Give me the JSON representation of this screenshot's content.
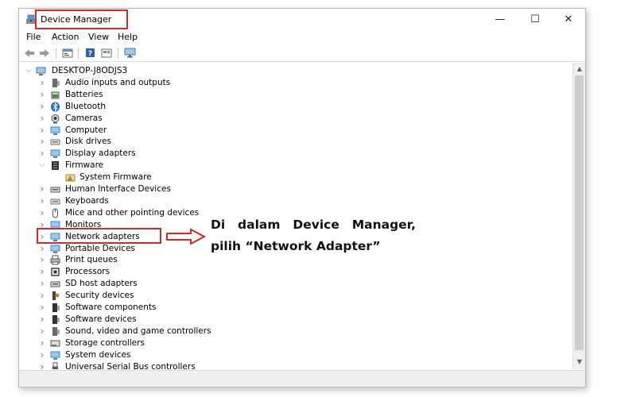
{
  "window": {
    "title": "Device Manager",
    "controls": {
      "minimize": "—",
      "maximize": "☐",
      "close": "✕"
    }
  },
  "menu": [
    "File",
    "Action",
    "View",
    "Help"
  ],
  "toolbar": {
    "buttons": [
      "back-icon",
      "forward-icon",
      "properties-icon",
      "help-icon",
      "view-icon",
      "monitor-icon"
    ]
  },
  "tree": {
    "root": "DESKTOP-J8ODJS3",
    "items": [
      {
        "label": "Audio inputs and outputs",
        "icon": "speaker-icon",
        "color": "#6b6b6b"
      },
      {
        "label": "Batteries",
        "icon": "battery-icon",
        "color": "#4a8a3a"
      },
      {
        "label": "Bluetooth",
        "icon": "bluetooth-icon",
        "color": "#1a6fd1"
      },
      {
        "label": "Cameras",
        "icon": "camera-icon",
        "color": "#555555"
      },
      {
        "label": "Computer",
        "icon": "computer-icon",
        "color": "#2a8fd8"
      },
      {
        "label": "Disk drives",
        "icon": "disk-icon",
        "color": "#777777"
      },
      {
        "label": "Display adapters",
        "icon": "display-icon",
        "color": "#2a8fd8"
      },
      {
        "label": "Firmware",
        "icon": "firmware-icon",
        "color": "#333333",
        "expanded": true
      },
      {
        "label": "System Firmware",
        "icon": "system-firmware-icon",
        "color": "#b08a2a",
        "child": true
      },
      {
        "label": "Human Interface Devices",
        "icon": "hid-icon",
        "color": "#555555"
      },
      {
        "label": "Keyboards",
        "icon": "keyboard-icon",
        "color": "#777777"
      },
      {
        "label": "Mice and other pointing devices",
        "icon": "mouse-icon",
        "color": "#555555"
      },
      {
        "label": "Monitors",
        "icon": "monitor-icon",
        "color": "#2a8fd8"
      },
      {
        "label": "Network adapters",
        "icon": "network-icon",
        "color": "#2a8fd8"
      },
      {
        "label": "Portable Devices",
        "icon": "portable-icon",
        "color": "#2a8fd8"
      },
      {
        "label": "Print queues",
        "icon": "printer-icon",
        "color": "#555555"
      },
      {
        "label": "Processors",
        "icon": "processor-icon",
        "color": "#333333"
      },
      {
        "label": "SD host adapters",
        "icon": "sd-icon",
        "color": "#555555"
      },
      {
        "label": "Security devices",
        "icon": "security-icon",
        "color": "#b08a2a"
      },
      {
        "label": "Software components",
        "icon": "software-components-icon",
        "color": "#333333"
      },
      {
        "label": "Software devices",
        "icon": "software-devices-icon",
        "color": "#333333"
      },
      {
        "label": "Sound, video and game controllers",
        "icon": "sound-icon",
        "color": "#6b6b6b"
      },
      {
        "label": "Storage controllers",
        "icon": "storage-icon",
        "color": "#6b8a3a"
      },
      {
        "label": "System devices",
        "icon": "system-devices-icon",
        "color": "#2a8fd8"
      },
      {
        "label": "Universal Serial Bus controllers",
        "icon": "usb-icon",
        "color": "#555555"
      }
    ]
  },
  "annotation": {
    "line1_words": [
      "Di",
      "dalam",
      "Device",
      "Manager,"
    ],
    "line2": "pilih “Network Adapter”"
  },
  "colors": {
    "highlight": "#d22a2a"
  }
}
